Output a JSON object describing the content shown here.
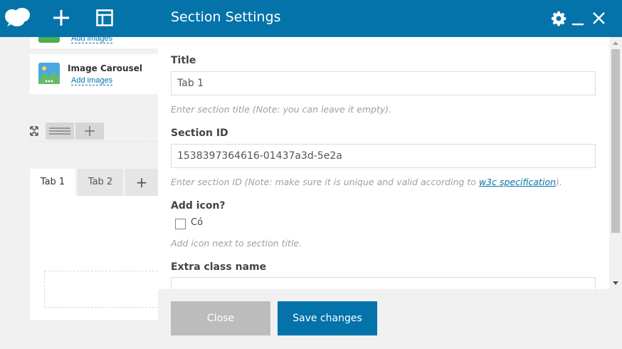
{
  "editor": {
    "elements": [
      {
        "name": "",
        "action": "Add images"
      },
      {
        "name": "Image Carousel",
        "action": "Add images"
      }
    ],
    "tabs": [
      "Tab 1",
      "Tab 2"
    ],
    "tab_add": "+"
  },
  "modal": {
    "title": "Section Settings",
    "fields": {
      "title": {
        "label": "Title",
        "value": "Tab 1",
        "help": "Enter section title (Note: you can leave it empty)."
      },
      "section_id": {
        "label": "Section ID",
        "value": "1538397364616-01437a3d-5e2a",
        "help_prefix": "Enter section ID (Note: make sure it is unique and valid according to ",
        "help_link": "w3c specification",
        "help_suffix": ")."
      },
      "add_icon": {
        "label": "Add icon?",
        "checkbox_label": "Có",
        "checked": false,
        "help": "Add icon next to section title."
      },
      "extra_class": {
        "label": "Extra class name",
        "value": ""
      }
    },
    "buttons": {
      "close": "Close",
      "save": "Save changes"
    }
  },
  "colors": {
    "brand": "#0473aa",
    "footer_bg": "#f1f1f1",
    "close_btn": "#bcbcbc"
  },
  "icons": [
    "cloud-logo-icon",
    "plus-icon",
    "layout-icon",
    "gear-icon",
    "minimize-icon",
    "close-icon",
    "fullscreen-icon",
    "drag-handle-icon"
  ]
}
